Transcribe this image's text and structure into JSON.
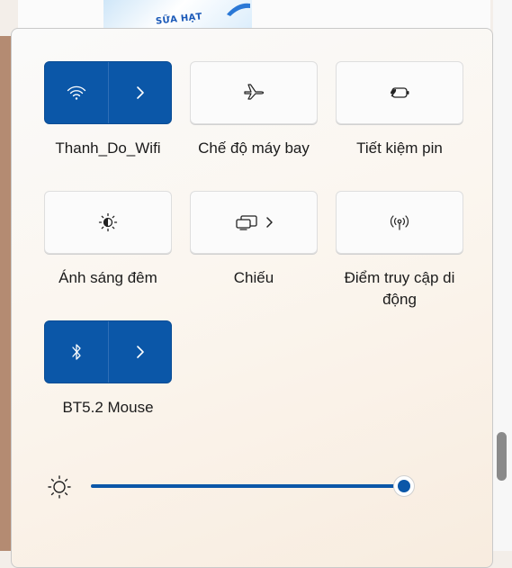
{
  "background": {
    "brand_text": "SỮA HẠT"
  },
  "quick_settings": {
    "tiles": [
      {
        "label": "Thanh_Do_Wifi",
        "icon": "wifi-icon",
        "state": "on"
      },
      {
        "label": "Chế độ máy bay",
        "icon": "airplane-icon",
        "state": "off"
      },
      {
        "label": "Tiết kiệm pin",
        "icon": "battery-saver-icon",
        "state": "off"
      },
      {
        "label": "Ánh sáng đêm",
        "icon": "night-light-icon",
        "state": "off"
      },
      {
        "label": "Chiếu",
        "icon": "project-icon",
        "state": "off"
      },
      {
        "label": "Điểm truy cập di động",
        "icon": "mobile-hotspot-icon",
        "state": "off"
      },
      {
        "label": "BT5.2 Mouse",
        "icon": "bluetooth-icon",
        "state": "on"
      }
    ]
  },
  "brightness": {
    "icon": "brightness-icon",
    "level_fraction": 1.0
  },
  "colors": {
    "accent": "#0b57a8",
    "tile_off": "#fbfbfb",
    "text": "#1b1b1b"
  }
}
